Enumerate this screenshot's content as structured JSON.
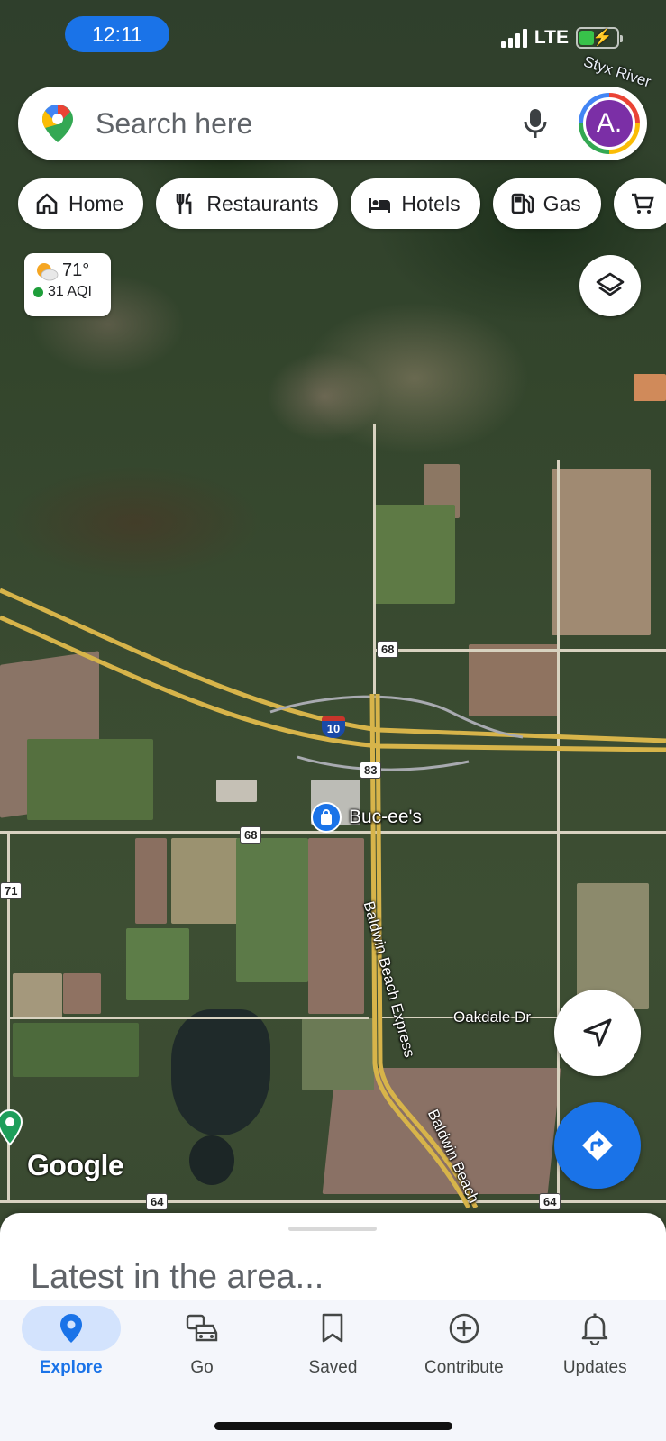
{
  "status_bar": {
    "time": "12:11",
    "network": "LTE"
  },
  "search": {
    "placeholder": "Search here",
    "avatar_initial": "A."
  },
  "chips": [
    {
      "label": "Home",
      "icon": "home-icon"
    },
    {
      "label": "Restaurants",
      "icon": "fork-knife-icon"
    },
    {
      "label": "Hotels",
      "icon": "bed-icon"
    },
    {
      "label": "Gas",
      "icon": "gas-pump-icon"
    }
  ],
  "weather": {
    "temperature": "71°",
    "aqi": "31 AQI"
  },
  "map": {
    "river_label": "Styx River",
    "place_label": "Buc-ee's",
    "street_label": "Oakdale Dr",
    "road_label_1": "Baldwin Beach Express",
    "road_label_2": "Baldwin Beach",
    "shields": {
      "s68a": "68",
      "s68b": "68",
      "s83": "83",
      "s71": "71",
      "s64a": "64",
      "s64b": "64",
      "interstate": "10"
    },
    "watermark": "Google"
  },
  "sheet": {
    "title": "Latest in the area..."
  },
  "nav": {
    "items": [
      {
        "label": "Explore",
        "icon": "pin-icon",
        "active": true
      },
      {
        "label": "Go",
        "icon": "car-icon"
      },
      {
        "label": "Saved",
        "icon": "bookmark-icon"
      },
      {
        "label": "Contribute",
        "icon": "add-circle-icon"
      },
      {
        "label": "Updates",
        "icon": "bell-icon"
      }
    ]
  },
  "colors": {
    "accent": "#1a73e8",
    "avatar": "#7b2fa6",
    "aqi_good": "#1e9e3a",
    "highway": "#d7b44a"
  }
}
